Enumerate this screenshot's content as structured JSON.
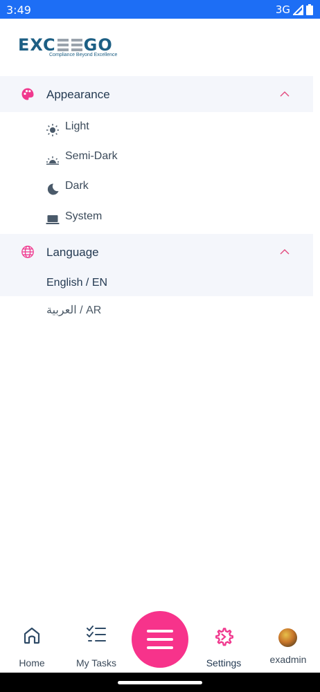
{
  "status_bar": {
    "time": "3:49",
    "network": "3G"
  },
  "logo": {
    "word_left": "EXC",
    "word_right": "GO",
    "tagline": "Compliance Beyond Excellence"
  },
  "appearance": {
    "title": "Appearance",
    "options": [
      {
        "label": "Light",
        "icon": "sun-icon"
      },
      {
        "label": "Semi-Dark",
        "icon": "sunset-icon"
      },
      {
        "label": "Dark",
        "icon": "moon-icon"
      },
      {
        "label": "System",
        "icon": "laptop-icon"
      }
    ]
  },
  "language": {
    "title": "Language",
    "options": [
      {
        "label": "English / EN",
        "selected": true
      },
      {
        "label": "العربية / AR",
        "selected": false
      }
    ]
  },
  "bottom_nav": {
    "home": "Home",
    "tasks": "My Tasks",
    "settings": "Settings",
    "profile": "exadmin"
  },
  "colors": {
    "accent": "#f7338b",
    "status_bar": "#1d6ef5",
    "text": "#243a52",
    "section_bg": "#f4f6fb"
  }
}
